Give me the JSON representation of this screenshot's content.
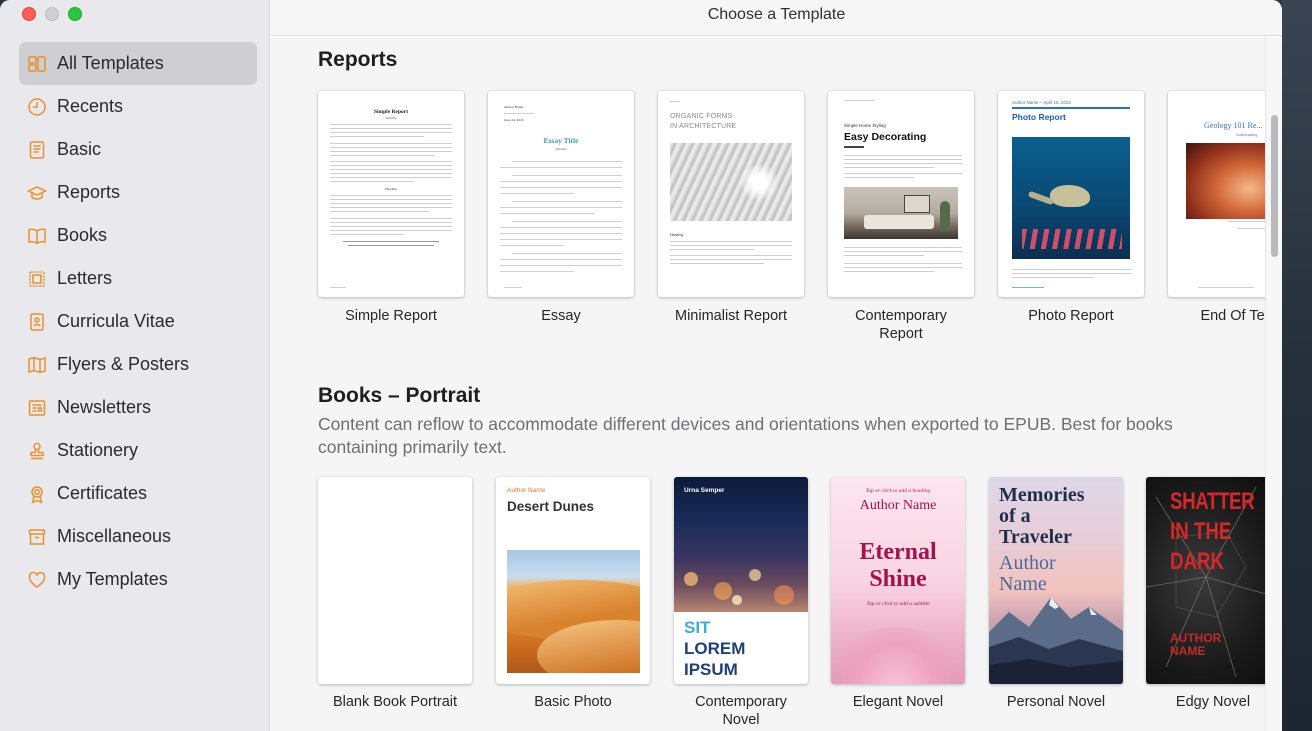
{
  "window": {
    "title": "Choose a Template"
  },
  "sidebar": {
    "items": [
      {
        "label": "All Templates",
        "icon": "all-templates-icon",
        "active": true
      },
      {
        "label": "Recents",
        "icon": "clock-icon"
      },
      {
        "label": "Basic",
        "icon": "document-icon"
      },
      {
        "label": "Reports",
        "icon": "graduation-cap-icon"
      },
      {
        "label": "Books",
        "icon": "book-icon"
      },
      {
        "label": "Letters",
        "icon": "stamp-icon"
      },
      {
        "label": "Curricula Vitae",
        "icon": "person-card-icon"
      },
      {
        "label": "Flyers & Posters",
        "icon": "map-icon"
      },
      {
        "label": "Newsletters",
        "icon": "newspaper-icon"
      },
      {
        "label": "Stationery",
        "icon": "stamp-icon"
      },
      {
        "label": "Certificates",
        "icon": "rosette-icon"
      },
      {
        "label": "Miscellaneous",
        "icon": "archive-box-icon"
      },
      {
        "label": "My Templates",
        "icon": "heart-icon"
      }
    ],
    "accent_color": "#e8912d"
  },
  "reports": {
    "title": "Reports",
    "templates": [
      {
        "label": "Simple Report",
        "title": "Simple Report",
        "subtitle": "Subtitle",
        "heading": "Heading"
      },
      {
        "label": "Essay",
        "title": "Essay Title",
        "subtitle": "Subtitle",
        "author": "Author Name",
        "date": "June 24, 2016"
      },
      {
        "label": "Minimalist Report",
        "title_line1": "ORGANIC FORMS",
        "title_line2": "IN ARCHITECTURE",
        "heading": "Heading"
      },
      {
        "label": "Contemporary\nReport",
        "kicker": "Simple Home Styling",
        "title": "Easy Decorating"
      },
      {
        "label": "Photo Report",
        "kicker": "Author Name – April 16, 2022",
        "title": "Photo Report"
      },
      {
        "label": "End Of Term",
        "title": "Geology 101 Re...",
        "subtitle": "Subheading"
      }
    ]
  },
  "books": {
    "title": "Books – Portrait",
    "description": "Content can reflow to accommodate different devices and orientations when exported to EPUB. Best for books containing primarily text.",
    "templates": [
      {
        "label": "Blank Book Portrait"
      },
      {
        "label": "Basic Photo",
        "author": "Author Name",
        "title": "Desert Dunes"
      },
      {
        "label": "Contemporary\nNovel",
        "author": "Urna Semper",
        "title_lines": [
          "SIT",
          "LOREM",
          "IPSUM"
        ]
      },
      {
        "label": "Elegant Novel",
        "heading_hint": "Tap or click to add a heading",
        "author": "Author Name",
        "title_line1": "Eternal",
        "title_line2": "Shine",
        "subtitle_hint": "Tap or click to add a subtitle"
      },
      {
        "label": "Personal Novel",
        "title_line1": "Memories",
        "title_line2": "of a",
        "title_line3": "Traveler",
        "author_line1": "Author",
        "author_line2": "Name"
      },
      {
        "label": "Edgy Novel",
        "title_lines": [
          "SHATTER",
          "IN THE",
          "DARK"
        ],
        "author": "AUTHOR NAME"
      }
    ]
  }
}
